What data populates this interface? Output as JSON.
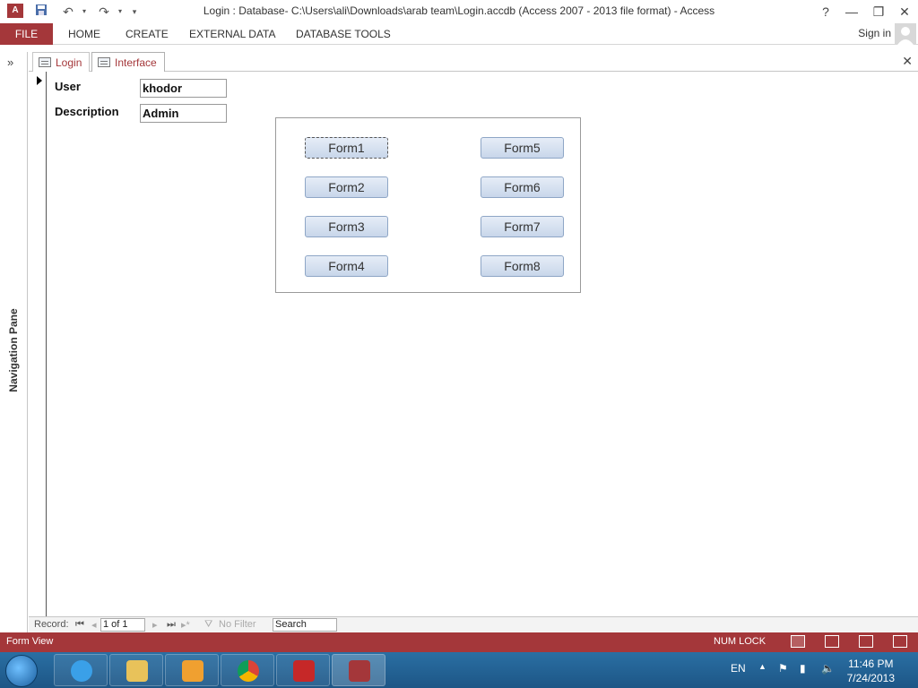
{
  "window": {
    "title": "Login : Database- C:\\Users\\ali\\Downloads\\arab team\\Login.accdb (Access 2007 - 2013 file format) - Access",
    "app_icon_text": "A",
    "help": "?",
    "minimize": "—",
    "restore": "❐",
    "close": "✕"
  },
  "ribbon": {
    "file": "FILE",
    "tabs": [
      "HOME",
      "CREATE",
      "EXTERNAL DATA",
      "DATABASE TOOLS"
    ],
    "sign_in": "Sign in"
  },
  "nav_pane": {
    "label": "Navigation Pane",
    "toggle": "»"
  },
  "doc_tabs": [
    {
      "label": "Login"
    },
    {
      "label": "Interface"
    }
  ],
  "doc_close": "✕",
  "form": {
    "user_label": "User",
    "user_value": "khodor",
    "description_label": "Description",
    "description_value": "Admin",
    "buttons_left": [
      "Form1",
      "Form2",
      "Form3",
      "Form4"
    ],
    "buttons_right": [
      "Form5",
      "Form6",
      "Form7",
      "Form8"
    ]
  },
  "record_nav": {
    "label": "Record:",
    "first": "⏮",
    "prev": "◂",
    "current": "1 of 1",
    "next": "▸",
    "last": "⏭",
    "new": "▸*",
    "filter": "No Filter",
    "search": "Search"
  },
  "status": {
    "mode": "Form View",
    "num_lock": "NUM LOCK"
  },
  "taskbar": {
    "lang": "EN",
    "time": "11:46 PM",
    "date": "7/24/2013"
  },
  "colors": {
    "accent": "#a4373a",
    "taskbar": "#2a6fa3"
  }
}
